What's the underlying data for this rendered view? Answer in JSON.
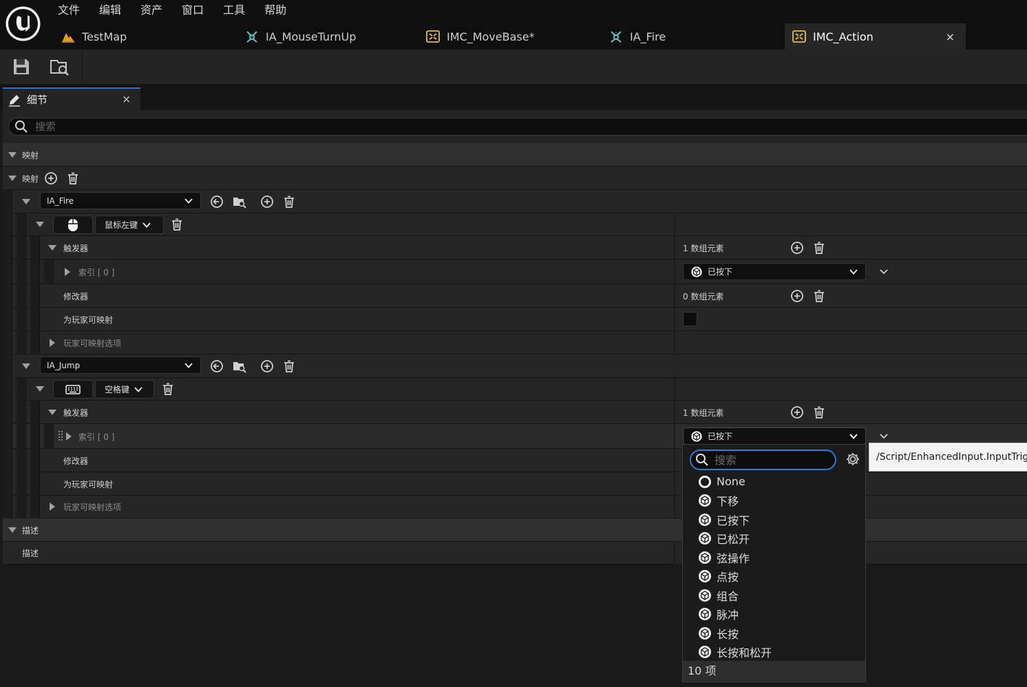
{
  "app": {
    "menu": [
      "文件",
      "编辑",
      "资产",
      "窗口",
      "工具",
      "帮助"
    ],
    "tabs": [
      {
        "label": "TestMap",
        "icon": "map-icon"
      },
      {
        "label": "IA_MouseTurnUp",
        "icon": "input-action-icon"
      },
      {
        "label": "IMC_MoveBase*",
        "icon": "input-mapping-context-icon"
      },
      {
        "label": "IA_Fire",
        "icon": "input-action-icon"
      },
      {
        "label": "IMC_Action",
        "icon": "input-mapping-context-icon",
        "active": true,
        "close": "×"
      }
    ],
    "toolbar": [
      "save-icon",
      "browse-content-icon"
    ]
  },
  "details": {
    "tab_title": "细节",
    "tab_close": "×",
    "search_placeholder": "搜索",
    "section_mappings": "映射",
    "mappings_label": "映射",
    "mappings": [
      {
        "action": "IA_Fire",
        "key_icon": "mouse-icon",
        "key": "鼠标左键",
        "triggers_label": "触发器",
        "triggers_count": "1 数组元素",
        "index_label": "索引 [ 0 ]",
        "trigger_value": "已按下",
        "modifiers_label": "修改器",
        "modifiers_count": "0 数组元素",
        "player_mappable_label": "为玩家可映射",
        "player_mappable": false,
        "player_options_label": "玩家可映射选项"
      },
      {
        "action": "IA_Jump",
        "key_icon": "keyboard-icon",
        "key": "空格键",
        "triggers_label": "触发器",
        "triggers_count": "1 数组元素",
        "index_label": "索引 [ 0 ]",
        "trigger_value": "已按下",
        "modifiers_label": "修改器",
        "player_mappable_label": "为玩家可映射",
        "player_options_label": "玩家可映射选项"
      }
    ],
    "section_description": "描述",
    "description_label": "描述"
  },
  "dropdown": {
    "search_placeholder": "搜索",
    "items": [
      "None",
      "下移",
      "已按下",
      "已松开",
      "弦操作",
      "点按",
      "组合",
      "脉冲",
      "长按",
      "长按和松开"
    ],
    "count": "10 项",
    "tooltip": "/Script/EnhancedInput.InputTriggerPressed"
  },
  "colors": {
    "accent": "#2f7bdc",
    "panel": "#242424",
    "category": "#2f2f2f",
    "tab_bar": "#0f0f0f"
  }
}
